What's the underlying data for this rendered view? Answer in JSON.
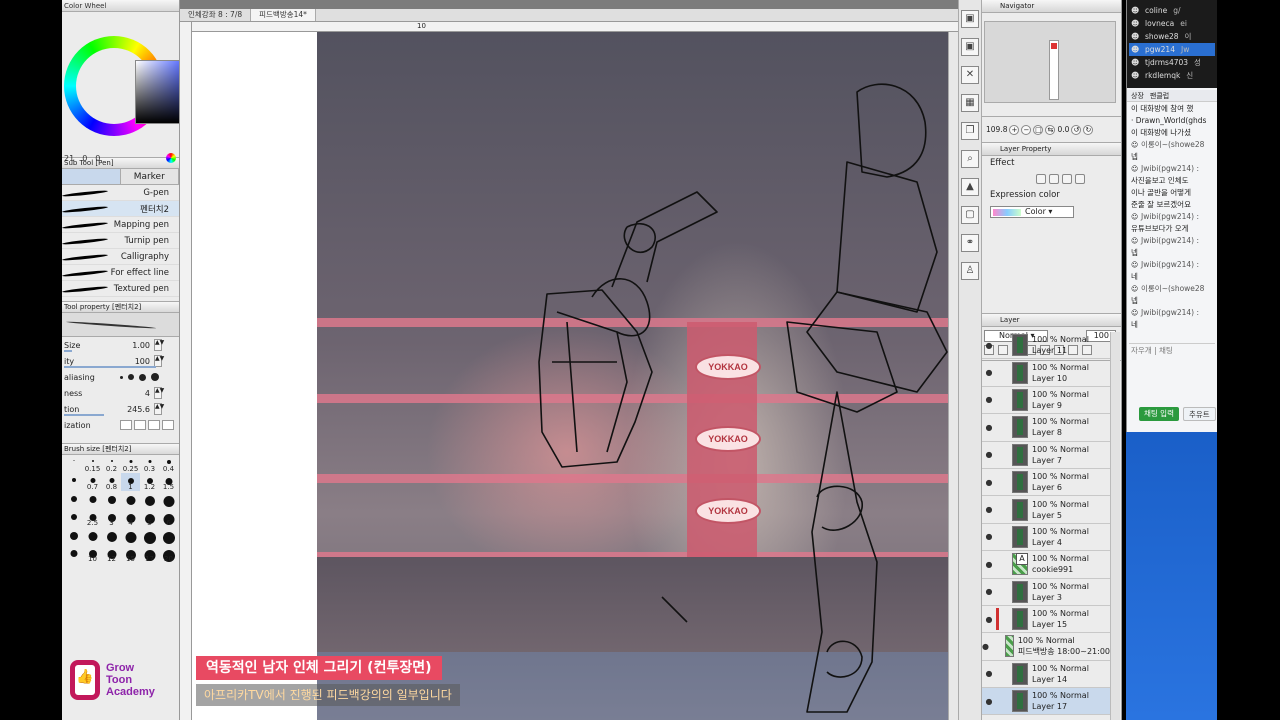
{
  "left_panel": {
    "color_wheel_title": "Color Wheel",
    "color_values": [
      "21",
      "0",
      "0"
    ],
    "subtool_title": "Sub Tool [Pen]",
    "subtool_tabs": [
      "",
      "Marker"
    ],
    "brushes": [
      "G-pen",
      "펜터치2",
      "Mapping pen",
      "Turnip pen",
      "Calligraphy",
      "For effect line",
      "Textured pen"
    ],
    "toolprop_title": "Tool property [펜터치2]",
    "props": {
      "size_label": "Size",
      "size_value": "1.00",
      "opacity_label": "ity",
      "opacity_value": "100",
      "aa_label": "aliasing",
      "hardness_label": "ness",
      "hardness_value": "4",
      "stab_label": "tion",
      "stab_value": "245.6",
      "vector_label": "ization"
    },
    "brushsize_title": "Brush size [펜터치2]",
    "brush_sizes": [
      "",
      "0.15",
      "0.2",
      "0.25",
      "0.3",
      "0.4",
      "",
      "0.7",
      "0.8",
      "1",
      "1.2",
      "1.5",
      "",
      "",
      "",
      "",
      "",
      "",
      "",
      "2.5",
      "3",
      "4",
      "5",
      "6",
      "",
      "",
      "",
      "",
      "",
      "",
      "",
      "10",
      "12",
      "15",
      "17",
      "20"
    ]
  },
  "logo": {
    "line1": "Grow",
    "line2": "Toon",
    "line3": "Academy"
  },
  "canvas": {
    "tabs": [
      "인체강좌 8 : 7/8",
      "피드백방송14*"
    ],
    "ruler_mark": "10",
    "ads": [
      "YOKKAO",
      "YOKKAO",
      "YOKKAO"
    ],
    "caption_title": "역동적인 남자 인체 그리기 (컨투장면)",
    "caption_sub": "아프리카TV에서 진행된 피드백강의의 일부입니다"
  },
  "navigator": {
    "title": "Navigator",
    "zoom": "109.8",
    "rotate": "0.0"
  },
  "layer_property": {
    "title": "Layer Property",
    "effect_label": "Effect",
    "expr_label": "Expression color",
    "expr_value": "Color"
  },
  "layer_panel": {
    "title": "Layer",
    "blend": "Normal",
    "opacity": "100",
    "layers": [
      {
        "pct": "100 %",
        "mode": "Normal",
        "name": "Layer 11",
        "kind": "normal"
      },
      {
        "pct": "100 %",
        "mode": "Normal",
        "name": "Layer 10",
        "kind": "normal"
      },
      {
        "pct": "100 %",
        "mode": "Normal",
        "name": "Layer 9",
        "kind": "normal"
      },
      {
        "pct": "100 %",
        "mode": "Normal",
        "name": "Layer 8",
        "kind": "normal"
      },
      {
        "pct": "100 %",
        "mode": "Normal",
        "name": "Layer 7",
        "kind": "normal"
      },
      {
        "pct": "100 %",
        "mode": "Normal",
        "name": "Layer 6",
        "kind": "normal"
      },
      {
        "pct": "100 %",
        "mode": "Normal",
        "name": "Layer 5",
        "kind": "normal"
      },
      {
        "pct": "100 %",
        "mode": "Normal",
        "name": "Layer 4",
        "kind": "normal"
      },
      {
        "pct": "100 %",
        "mode": "Normal",
        "name": "cookie991",
        "kind": "text"
      },
      {
        "pct": "100 %",
        "mode": "Normal",
        "name": "Layer 3",
        "kind": "normal"
      },
      {
        "pct": "100 %",
        "mode": "Normal",
        "name": "Layer 15",
        "kind": "red"
      },
      {
        "pct": "100 %",
        "mode": "Normal",
        "name": "피드백방송 18:00~21:00",
        "kind": "text"
      },
      {
        "pct": "100 %",
        "mode": "Normal",
        "name": "Layer 14",
        "kind": "normal"
      },
      {
        "pct": "100 %",
        "mode": "Normal",
        "name": "Layer 17",
        "kind": "selected"
      }
    ]
  },
  "chat": {
    "viewers": [
      {
        "name": "coline",
        "extra": "g/"
      },
      {
        "name": "lovneca",
        "extra": "ei"
      },
      {
        "name": "showe28",
        "extra": "이"
      },
      {
        "name": "pgw214",
        "extra": "Jw"
      },
      {
        "name": "tjdrms4703",
        "extra": "성"
      },
      {
        "name": "rkdlemqk",
        "extra": "신"
      }
    ],
    "tabs": [
      "상장",
      "팬클럽"
    ],
    "messages": [
      {
        "who": "",
        "text": "이 대화방에 참여 했"
      },
      {
        "who": "",
        "text": "· Drawn_World(ghds"
      },
      {
        "who": "",
        "text": "이 대화방에 나가셨"
      },
      {
        "who": "이롱이~(showe28",
        "text": "넵"
      },
      {
        "who": "Jwibi(pgw214) :",
        "text": "사진을보고 인체도"
      },
      {
        "who": "",
        "text": "이나 골반을 어떻게"
      },
      {
        "who": "",
        "text": "준줄 잘 보르겠어요"
      },
      {
        "who": "Jwibi(pgw214) :",
        "text": "유튜브보다가 오게"
      },
      {
        "who": "Jwibi(pgw214) :",
        "text": "넵"
      },
      {
        "who": "Jwibi(pgw214) :",
        "text": "네"
      },
      {
        "who": "이롱이~(showe28",
        "text": "넵"
      },
      {
        "who": "Jwibi(pgw214) :",
        "text": "네"
      }
    ],
    "input_placeholder": "자우개 | 채팅",
    "send_label": "채팅 입력",
    "login_label": "추유트"
  }
}
